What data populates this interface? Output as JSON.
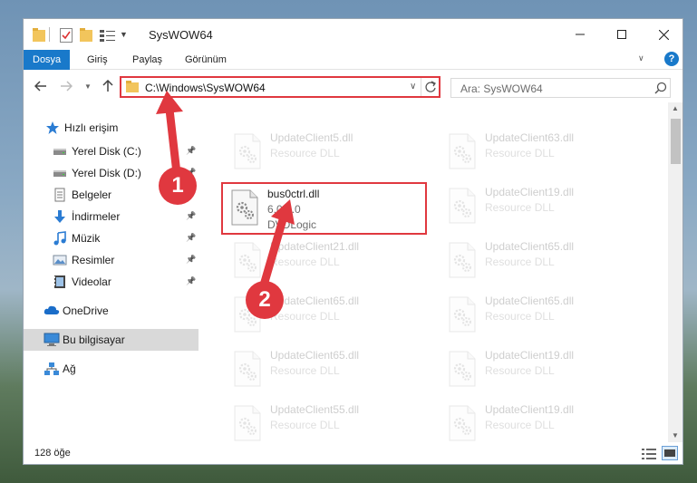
{
  "window": {
    "title": "SysWOW64"
  },
  "ribbon": {
    "tabs": [
      "Dosya",
      "Giriş",
      "Paylaş",
      "Görünüm"
    ],
    "help": "?"
  },
  "nav": {
    "address_path": "C:\\Windows\\SysWOW64",
    "search_placeholder": "Ara: SysWOW64"
  },
  "sidebar": {
    "items": [
      {
        "label": "Hızlı erişim",
        "icon": "star-icon"
      },
      {
        "label": "Yerel Disk (C:)",
        "icon": "drive-icon",
        "pinned": true
      },
      {
        "label": "Yerel Disk (D:)",
        "icon": "drive-icon",
        "pinned": true
      },
      {
        "label": "Belgeler",
        "icon": "documents-icon",
        "pinned": true
      },
      {
        "label": "İndirmeler",
        "icon": "download-icon",
        "pinned": true
      },
      {
        "label": "Müzik",
        "icon": "music-icon",
        "pinned": true
      },
      {
        "label": "Resimler",
        "icon": "pictures-icon",
        "pinned": true
      },
      {
        "label": "Videolar",
        "icon": "videos-icon",
        "pinned": true
      },
      {
        "label": "OneDrive",
        "icon": "cloud-icon"
      },
      {
        "label": "Bu bilgisayar",
        "icon": "computer-icon",
        "selected": true
      },
      {
        "label": "Ağ",
        "icon": "network-icon"
      }
    ]
  },
  "files": {
    "highlighted": {
      "name": "bus0ctrl.dll",
      "version": "6.0.0.0",
      "company": "DVDLogic"
    },
    "left_column": [
      {
        "name": "UpdateClient5.dll",
        "desc": "Resource DLL"
      },
      {
        "name": "UpdateClient21.dll",
        "desc": "Resource DLL"
      },
      {
        "name": "UpdateClient65.dll",
        "desc": "Resource DLL"
      },
      {
        "name": "UpdateClient65.dll",
        "desc": "Resource DLL"
      },
      {
        "name": "UpdateClient55.dll",
        "desc": "Resource DLL"
      }
    ],
    "right_column": [
      {
        "name": "UpdateClient63.dll",
        "desc": "Resource DLL"
      },
      {
        "name": "UpdateClient19.dll",
        "desc": "Resource DLL"
      },
      {
        "name": "UpdateClient65.dll",
        "desc": "Resource DLL"
      },
      {
        "name": "UpdateClient65.dll",
        "desc": "Resource DLL"
      },
      {
        "name": "UpdateClient19.dll",
        "desc": "Resource DLL"
      },
      {
        "name": "UpdateClient19.dll",
        "desc": "Resource DLL"
      }
    ]
  },
  "status": {
    "count": "128 öğe"
  },
  "annotations": {
    "step1": "1",
    "step2": "2"
  },
  "colors": {
    "accent": "#1979ca",
    "highlight": "#e0383f"
  }
}
